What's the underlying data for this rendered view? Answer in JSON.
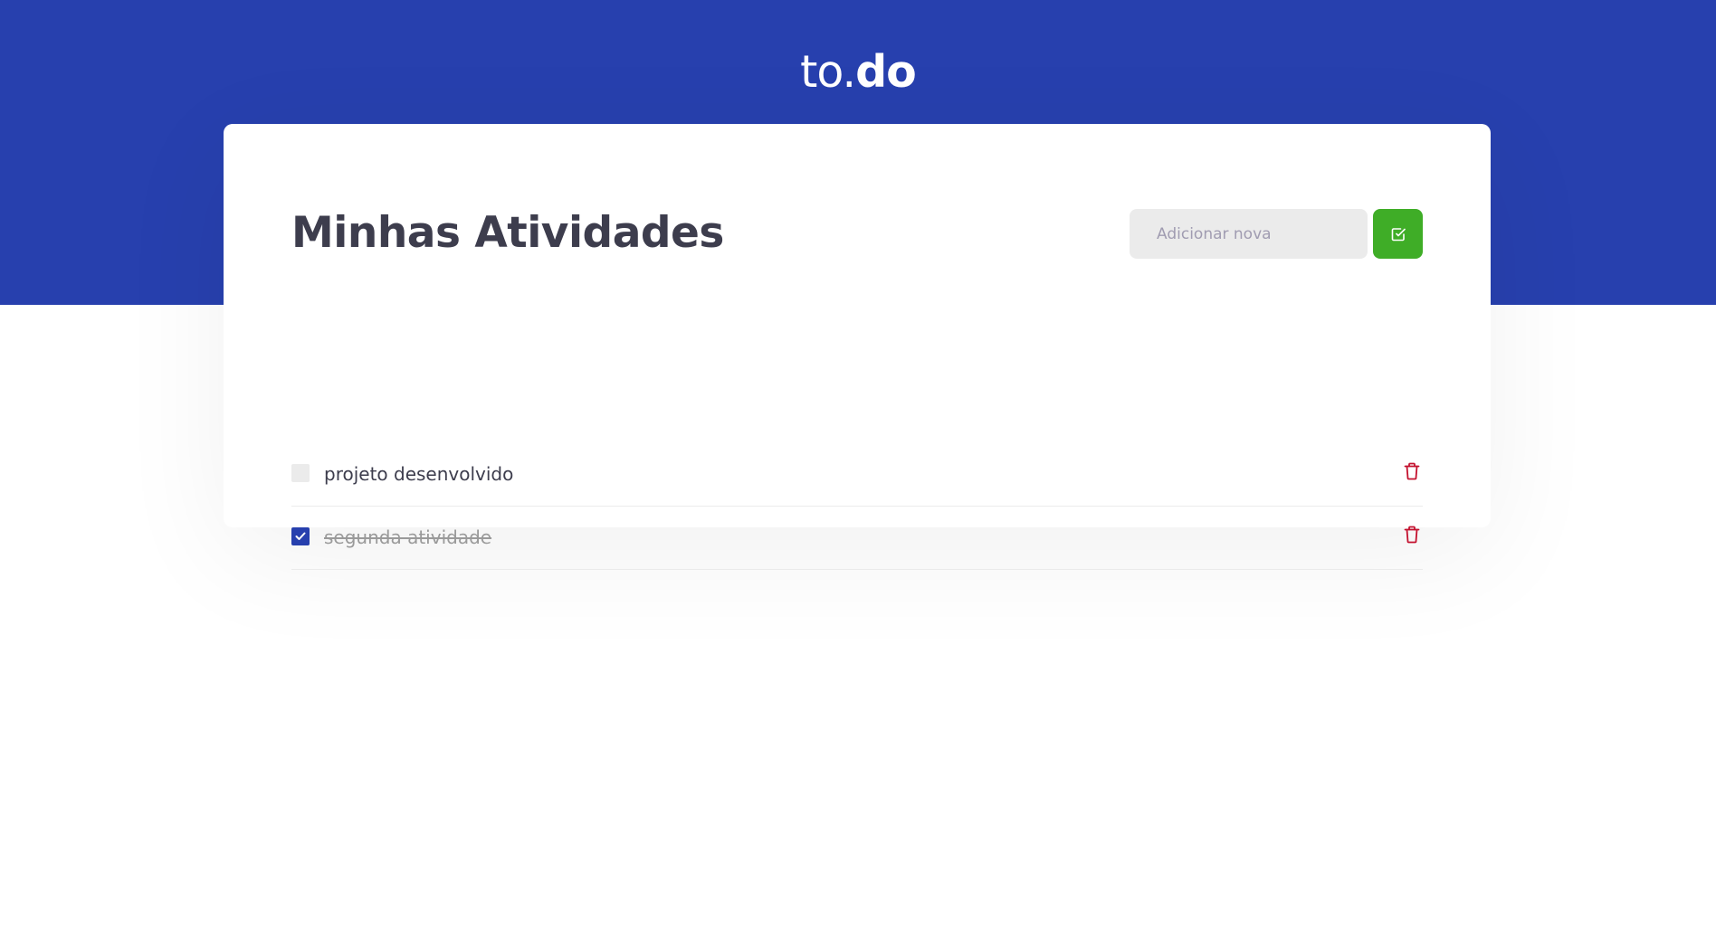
{
  "header": {
    "logo_prefix": "to.",
    "logo_suffix": "do",
    "background_color": "#2740ae"
  },
  "card": {
    "title": "Minhas Atividades"
  },
  "new_task": {
    "placeholder": "Adicionar nova",
    "value": "",
    "add_button_icon": "check-square-icon",
    "add_button_color": "#3fad27"
  },
  "tasks": [
    {
      "title": "projeto desenvolvido",
      "completed": false,
      "delete_icon": "trash-icon"
    },
    {
      "title": "segunda atividade",
      "completed": true,
      "delete_icon": "trash-icon"
    }
  ],
  "colors": {
    "checked": "#2740ae",
    "delete": "#c4122f",
    "text": "#3d3d4d"
  }
}
